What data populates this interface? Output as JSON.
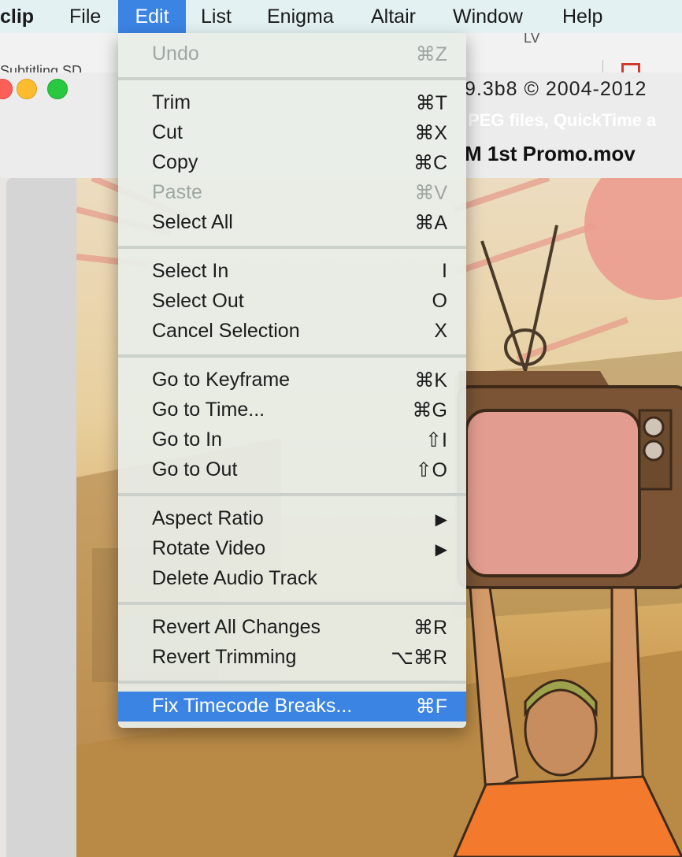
{
  "menubar": {
    "app": "clip",
    "items": [
      "File",
      "Edit",
      "List",
      "Enigma",
      "Altair",
      "Window",
      "Help"
    ]
  },
  "window": {
    "toolbar_text": "Subtitling SD",
    "toolbar_right": "LV",
    "title": "9.3b8 © 2004-2012",
    "info_line": "PEG files, QuickTime a",
    "filename": "M 1st Promo.mov"
  },
  "edit_menu": {
    "groups": [
      [
        {
          "label": "Undo",
          "shortcut": "⌘Z",
          "disabled": true
        }
      ],
      [
        {
          "label": "Trim",
          "shortcut": "⌘T"
        },
        {
          "label": "Cut",
          "shortcut": "⌘X"
        },
        {
          "label": "Copy",
          "shortcut": "⌘C"
        },
        {
          "label": "Paste",
          "shortcut": "⌘V",
          "disabled": true
        },
        {
          "label": "Select All",
          "shortcut": "⌘A"
        }
      ],
      [
        {
          "label": "Select In",
          "shortcut": "I"
        },
        {
          "label": "Select Out",
          "shortcut": "O"
        },
        {
          "label": "Cancel Selection",
          "shortcut": "X"
        }
      ],
      [
        {
          "label": "Go to Keyframe",
          "shortcut": "⌘K"
        },
        {
          "label": "Go to Time...",
          "shortcut": "⌘G"
        },
        {
          "label": "Go to In",
          "shortcut": "⇧I"
        },
        {
          "label": "Go to Out",
          "shortcut": "⇧O"
        }
      ],
      [
        {
          "label": "Aspect Ratio",
          "shortcut": "▶"
        },
        {
          "label": "Rotate Video",
          "shortcut": "▶"
        },
        {
          "label": "Delete Audio Track",
          "shortcut": ""
        }
      ],
      [
        {
          "label": "Revert All Changes",
          "shortcut": "⌘R"
        },
        {
          "label": "Revert Trimming",
          "shortcut": "⌥⌘R"
        }
      ],
      [
        {
          "label": "Fix Timecode Breaks...",
          "shortcut": "⌘F",
          "selected": true
        }
      ]
    ]
  }
}
